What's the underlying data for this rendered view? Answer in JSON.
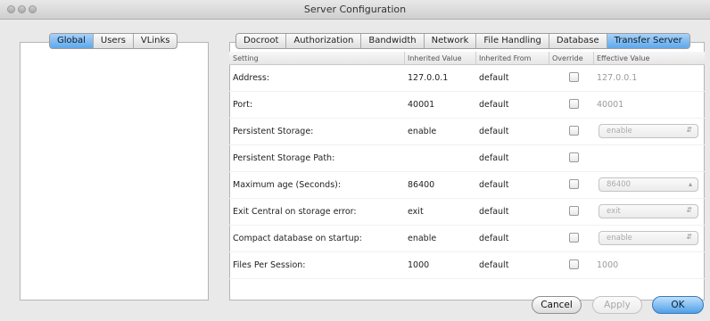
{
  "window": {
    "title": "Server Configuration"
  },
  "left_tabs": [
    "Global",
    "Users",
    "VLinks"
  ],
  "right_tabs": [
    "Docroot",
    "Authorization",
    "Bandwidth",
    "Network",
    "File Handling",
    "Database",
    "Transfer Server"
  ],
  "table": {
    "headers": [
      "Setting",
      "Inherited Value",
      "Inherited From",
      "Override",
      "Effective Value"
    ],
    "rows": [
      {
        "setting": "Address:",
        "inherited_value": "127.0.0.1",
        "inherited_from": "default",
        "effective": "127.0.0.1",
        "control": "text"
      },
      {
        "setting": "Port:",
        "inherited_value": "40001",
        "inherited_from": "default",
        "effective": "40001",
        "control": "text"
      },
      {
        "setting": "Persistent Storage:",
        "inherited_value": "enable",
        "inherited_from": "default",
        "effective": "enable",
        "control": "select"
      },
      {
        "setting": "Persistent Storage Path:",
        "inherited_value": "",
        "inherited_from": "default",
        "effective": "",
        "control": "none"
      },
      {
        "setting": "Maximum age (Seconds):",
        "inherited_value": "86400",
        "inherited_from": "default",
        "effective": "86400",
        "control": "spinner"
      },
      {
        "setting": "Exit Central on storage error:",
        "inherited_value": "exit",
        "inherited_from": "default",
        "effective": "exit",
        "control": "select"
      },
      {
        "setting": "Compact database on startup:",
        "inherited_value": "enable",
        "inherited_from": "default",
        "effective": "enable",
        "control": "select"
      },
      {
        "setting": "Files Per Session:",
        "inherited_value": "1000",
        "inherited_from": "default",
        "effective": "1000",
        "control": "text"
      }
    ]
  },
  "buttons": {
    "cancel": "Cancel",
    "apply": "Apply",
    "ok": "OK"
  },
  "colors": {
    "accent": "#5ea8ec",
    "window_bg": "#e9e9e9",
    "panel_bg": "#ffffff"
  }
}
